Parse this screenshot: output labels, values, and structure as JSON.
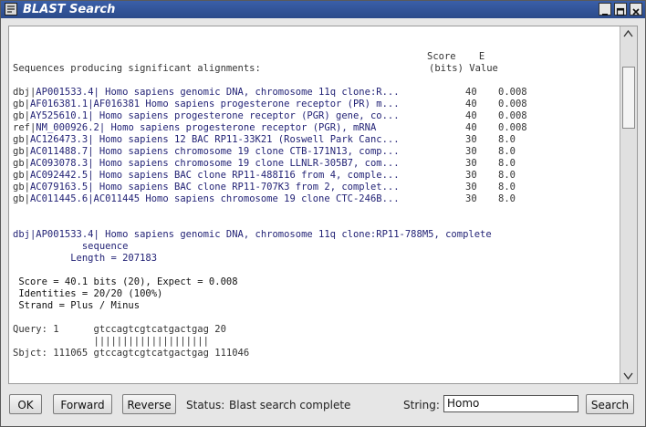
{
  "window": {
    "title": "BLAST Search"
  },
  "summary": {
    "header_score_line": "Score    E",
    "header_label": "Sequences producing significant alignments:",
    "header_units": "(bits) Value",
    "rows": [
      {
        "prefix": "dbj|",
        "link": "AP001533.4",
        "desc": "| Homo sapiens genomic DNA, chromosome 11q clone:R...",
        "score": "40",
        "evalue": "0.008"
      },
      {
        "prefix": "gb|",
        "link": "AF016381.1",
        "desc": "|AF016381 Homo sapiens progesterone receptor (PR) m...",
        "score": "40",
        "evalue": "0.008"
      },
      {
        "prefix": "gb|",
        "link": "AY525610.1",
        "desc": "| Homo sapiens progesterone receptor (PGR) gene, co...",
        "score": "40",
        "evalue": "0.008"
      },
      {
        "prefix": "ref|",
        "link": "NM_000926.2",
        "desc": "| Homo sapiens progesterone receptor (PGR), mRNA",
        "score": "40",
        "evalue": "0.008"
      },
      {
        "prefix": "gb|",
        "link": "AC126473.3",
        "desc": "| Homo sapiens 12 BAC RP11-33K21 (Roswell Park Canc...",
        "score": "30",
        "evalue": "8.0"
      },
      {
        "prefix": "gb|",
        "link": "AC011488.7",
        "desc": "| Homo sapiens chromosome 19 clone CTB-171N13, comp...",
        "score": "30",
        "evalue": "8.0"
      },
      {
        "prefix": "gb|",
        "link": "AC093078.3",
        "desc": "| Homo sapiens chromosome 19 clone LLNLR-305B7, com...",
        "score": "30",
        "evalue": "8.0"
      },
      {
        "prefix": "gb|",
        "link": "AC092442.5",
        "desc": "| Homo sapiens BAC clone RP11-488I16 from 4, comple...",
        "score": "30",
        "evalue": "8.0"
      },
      {
        "prefix": "gb|",
        "link": "AC079163.5",
        "desc": "| Homo sapiens BAC clone RP11-707K3 from 2, complet...",
        "score": "30",
        "evalue": "8.0"
      },
      {
        "prefix": "gb|",
        "link": "AC011445.6",
        "desc": "|AC011445 Homo sapiens chromosome 19 clone CTC-246B...",
        "score": "30",
        "evalue": "8.0"
      }
    ]
  },
  "detail": {
    "line1": "dbj|AP001533.4| Homo sapiens genomic DNA, chromosome 11q clone:RP11-788M5, complete",
    "line2": "            sequence",
    "length": "          Length = 207183",
    "score": " Score = 40.1 bits (20), Expect = 0.008",
    "identities": " Identities = 20/20 (100%)",
    "strand": " Strand = Plus / Minus",
    "query": "Query: 1      gtccagtcgtcatgactgag 20",
    "bars": "              ||||||||||||||||||||",
    "sbjct": "Sbjct: 111065 gtccagtcgtcatgactgag 111046"
  },
  "bottom": {
    "ok": "OK",
    "forward": "Forward",
    "reverse": "Reverse",
    "status_label": "Status:",
    "status_text": "Blast search complete",
    "string_label": "String:",
    "string_value": "Homo",
    "search": "Search"
  },
  "icons": {
    "app": "blast-app-icon",
    "minimize": "minimize-icon",
    "maximize": "maximize-icon",
    "close": "close-icon",
    "scroll_up": "arrow-up-icon",
    "scroll_down": "arrow-down-icon"
  }
}
